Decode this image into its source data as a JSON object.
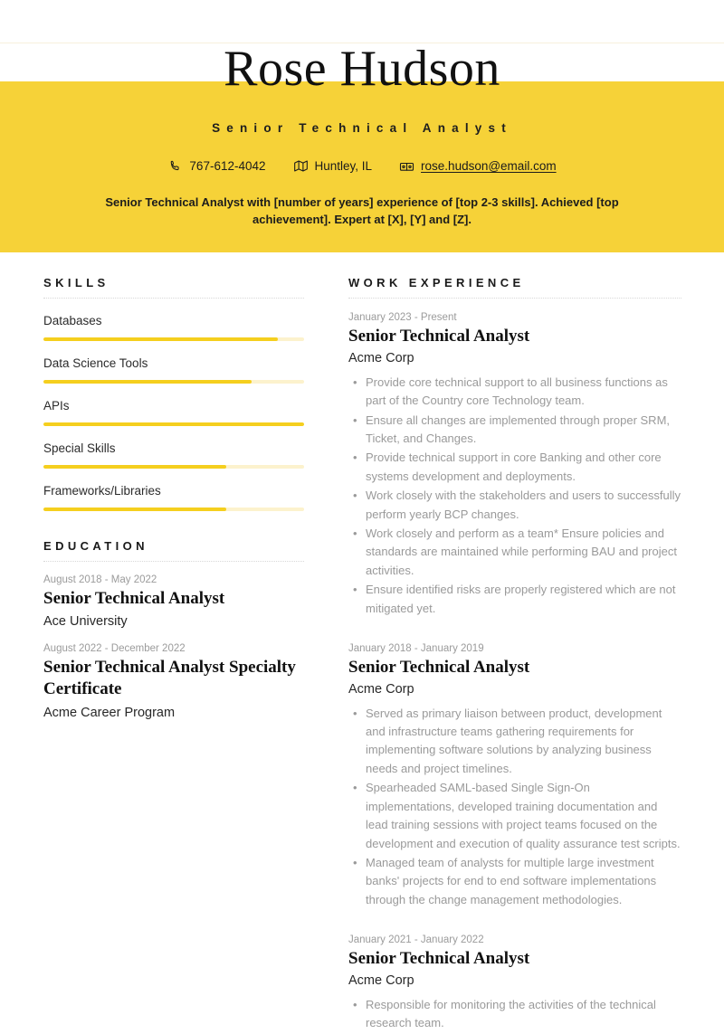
{
  "header": {
    "name": "Rose Hudson",
    "job_subtitle": "Senior Technical Analyst",
    "contact": {
      "phone": "767-612-4042",
      "location": "Huntley, IL",
      "email": "rose.hudson@email.com"
    },
    "summary": "Senior Technical Analyst with [number of years] experience of [top 2-3 skills]. Achieved [top achievement]. Expert at [X], [Y] and [Z]."
  },
  "theme": {
    "accent_yellow": "#F6D238",
    "bar_fill": "#F5CF1E",
    "bar_track": "#FCF2CD",
    "muted_text": "#9A9A9A"
  },
  "skills": {
    "title": "SKILLS",
    "items": [
      {
        "label": "Databases",
        "level": 90
      },
      {
        "label": "Data Science Tools",
        "level": 80
      },
      {
        "label": "APIs",
        "level": 100
      },
      {
        "label": "Special Skills",
        "level": 70
      },
      {
        "label": "Frameworks/Libraries",
        "level": 70
      }
    ]
  },
  "education": {
    "title": "EDUCATION",
    "entries": [
      {
        "date": "August 2018 - May 2022",
        "title": "Senior Technical Analyst",
        "org": "Ace University"
      },
      {
        "date": "August 2022 - December 2022",
        "title": "Senior Technical Analyst Specialty Certificate",
        "org": "Acme Career Program"
      }
    ]
  },
  "work_experience": {
    "title": "WORK EXPERIENCE",
    "jobs": [
      {
        "date": "January 2023 - Present",
        "title": "Senior Technical Analyst",
        "company": "Acme Corp",
        "bullets": [
          "Provide core technical support to all business functions as part of the Country core Technology team.",
          "Ensure all changes are implemented through proper SRM, Ticket, and Changes.",
          "Provide technical support in core Banking and other core systems development and deployments.",
          "Work closely with the stakeholders and users to successfully perform yearly BCP changes.",
          "Work closely and perform as a team* Ensure policies and standards are maintained while performing BAU and project activities.",
          "Ensure identified risks are properly registered which are not mitigated yet."
        ]
      },
      {
        "date": "January 2018 - January 2019",
        "title": "Senior Technical Analyst",
        "company": "Acme Corp",
        "bullets": [
          "Served as primary liaison between product, development and infrastructure teams gathering requirements for implementing software solutions by analyzing business needs and project timelines.",
          "Spearheaded SAML-based Single Sign-On implementations, developed training documentation and lead training sessions with project teams focused on the development and execution of quality assurance test scripts.",
          "Managed team of analysts for multiple large investment banks' projects for end to end software implementations through the change management methodologies."
        ]
      },
      {
        "date": "January 2021 - January 2022",
        "title": "Senior Technical Analyst",
        "company": "Acme Corp",
        "bullets": [
          "Responsible for monitoring the activities of the technical research team."
        ]
      }
    ]
  }
}
